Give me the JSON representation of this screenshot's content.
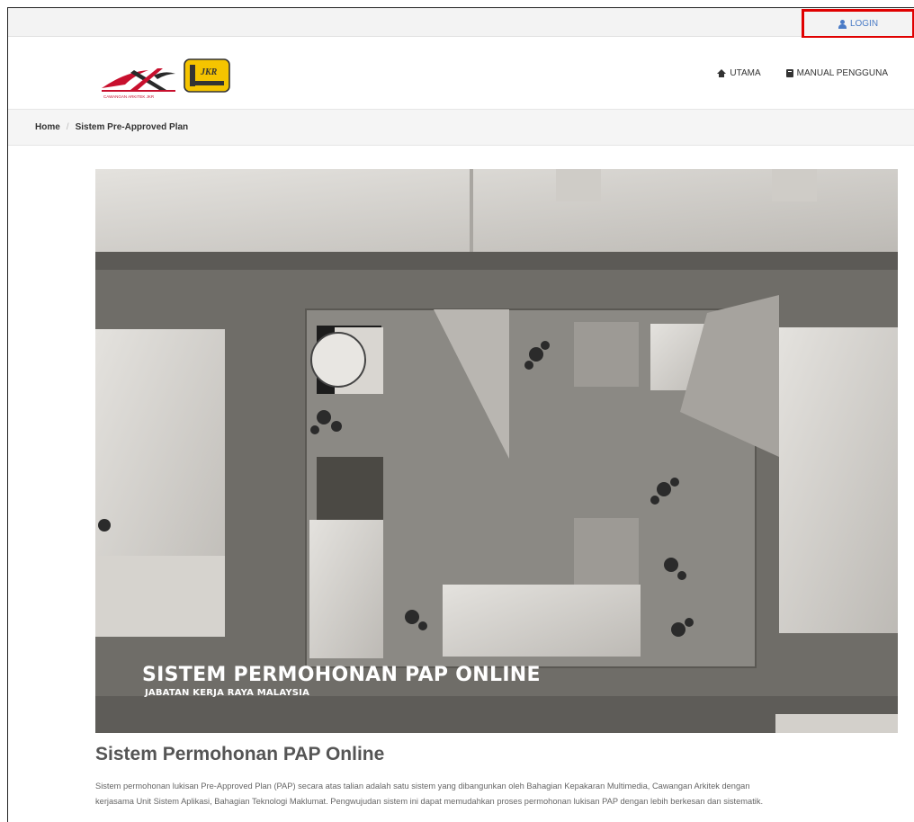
{
  "topbar": {
    "login_label": "LOGIN"
  },
  "header": {
    "logo_caption": "CAWANGAN ARKITEK JKR",
    "badge_text": "JKR",
    "nav": [
      {
        "label": "UTAMA",
        "icon": "home-icon"
      },
      {
        "label": "MANUAL PENGGUNA",
        "icon": "book-icon"
      }
    ]
  },
  "breadcrumb": {
    "home": "Home",
    "separator": "/",
    "current": "Sistem Pre-Approved Plan"
  },
  "hero": {
    "title": "SISTEM PERMOHONAN PAP ONLINE",
    "subtitle": "JABATAN KERJA RAYA MALAYSIA"
  },
  "content": {
    "heading": "Sistem Permohonan PAP Online",
    "intro_line1": "Sistem permohonan lukisan Pre-Approved Plan (PAP) secara atas talian adalah satu sistem yang dibangunkan oleh Bahagian Kepakaran Multimedia, Cawangan Arkitek dengan",
    "intro_line2": "kerjasama Unit Sistem Aplikasi, Bahagian Teknologi Maklumat. Pengwujudan sistem ini dapat memudahkan proses permohonan lukisan PAP dengan lebih berkesan dan sistematik."
  },
  "colors": {
    "login_highlight": "#e00000",
    "link": "#4a7bc6",
    "logo_red": "#c8102e",
    "badge_yellow": "#f5c400"
  }
}
